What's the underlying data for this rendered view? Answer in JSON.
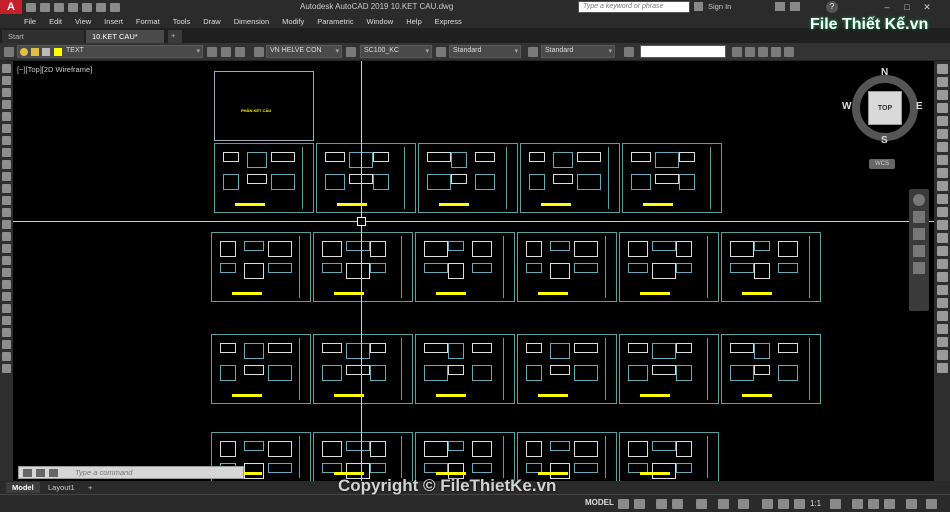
{
  "titlebar": {
    "app_logo": "A",
    "title": "Autodesk AutoCAD 2019    10.KET CAU.dwg",
    "search_placeholder": "Type a keyword or phrase",
    "sign_in": "Sign In",
    "help": "?"
  },
  "menu": [
    "File",
    "Edit",
    "View",
    "Insert",
    "Format",
    "Tools",
    "Draw",
    "Dimension",
    "Modify",
    "Parametric",
    "Window",
    "Help",
    "Express"
  ],
  "tabs": [
    {
      "label": "Start",
      "active": false
    },
    {
      "label": "10.KET CAU*",
      "active": true
    },
    {
      "label": "+"
    }
  ],
  "properties_toolbar": {
    "layer": "TEXT",
    "text_style": "VN HELVE CON",
    "dim_style": "SC100_KC",
    "table_style": "Standard",
    "multileader_style": "Standard",
    "layer_color_hex": "#ffff00"
  },
  "viewport": {
    "label": "[−][Top][2D Wireframe]"
  },
  "viewcube": {
    "face": "TOP",
    "north": "N",
    "south": "S",
    "east": "E",
    "west": "W",
    "wcs": "WCS"
  },
  "drawing_sheets": {
    "cover_title": "PHẦN KẾT CẤU",
    "row1_count": 5,
    "row2_count": 6,
    "row3_count": 6,
    "row4_count": 5
  },
  "command_line": {
    "placeholder": "Type a command"
  },
  "layout_tabs": [
    "Model",
    "Layout1",
    "+"
  ],
  "statusbar": {
    "model": "MODEL",
    "scale": "1:1"
  },
  "watermark": {
    "copyright": "Copyright © FileThietKe.vn",
    "logo": "File Thiết Kế.vn"
  },
  "colors": {
    "accent_red": "#c5202a",
    "drawing_border": "#5aa0a0",
    "drawing_text_yellow": "#ffff00",
    "background": "#000000"
  }
}
